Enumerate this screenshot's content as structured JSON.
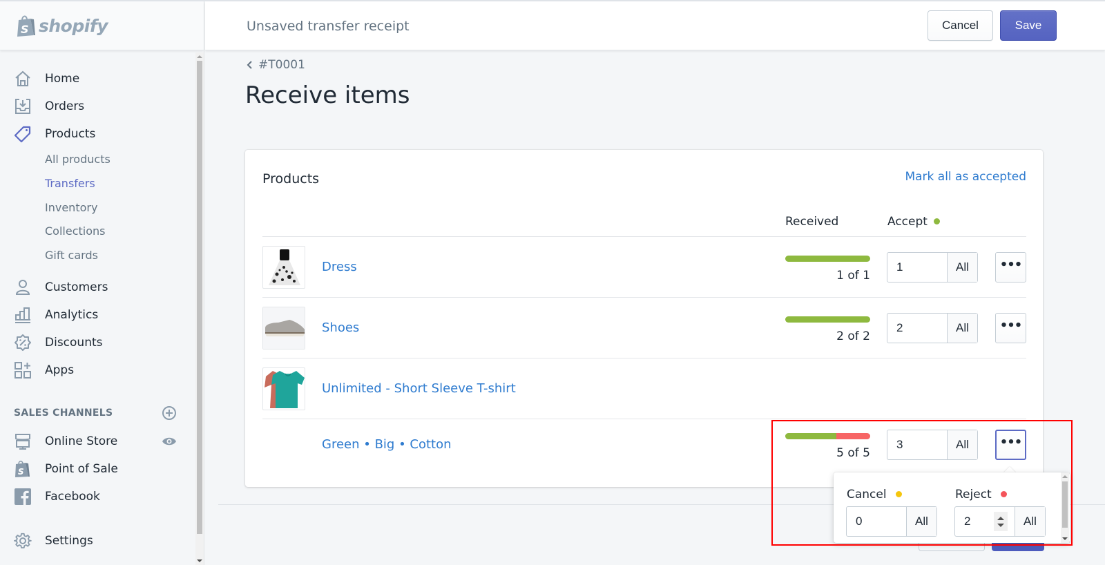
{
  "app": {
    "brand": "shopify"
  },
  "header": {
    "title": "Unsaved transfer receipt",
    "cancel_label": "Cancel",
    "save_label": "Save"
  },
  "sidebar": {
    "items": [
      {
        "label": "Home",
        "icon": "home-icon"
      },
      {
        "label": "Orders",
        "icon": "orders-icon"
      },
      {
        "label": "Products",
        "icon": "tag-icon",
        "active": true
      },
      {
        "label": "Customers",
        "icon": "customer-icon"
      },
      {
        "label": "Analytics",
        "icon": "analytics-icon"
      },
      {
        "label": "Discounts",
        "icon": "discount-icon"
      },
      {
        "label": "Apps",
        "icon": "apps-icon"
      }
    ],
    "product_subitems": [
      {
        "label": "All products"
      },
      {
        "label": "Transfers",
        "active": true
      },
      {
        "label": "Inventory"
      },
      {
        "label": "Collections"
      },
      {
        "label": "Gift cards"
      }
    ],
    "sales_channels_title": "SALES CHANNELS",
    "channels": [
      {
        "label": "Online Store",
        "icon": "store-icon"
      },
      {
        "label": "Point of Sale",
        "icon": "shopify-bag-icon"
      },
      {
        "label": "Facebook",
        "icon": "facebook-icon"
      }
    ],
    "settings_label": "Settings"
  },
  "page": {
    "breadcrumb": "#T0001",
    "title": "Receive items"
  },
  "card": {
    "title": "Products",
    "mark_all_label": "Mark all as accepted",
    "columns": {
      "received": "Received",
      "accept": "Accept"
    },
    "rows": [
      {
        "name": "Dress",
        "image": "dress",
        "received": 1,
        "total": 1,
        "received_text": "1 of 1",
        "accept_value": "1",
        "all_label": "All",
        "bar": {
          "accepted": 1.0,
          "rejected": 0.0
        }
      },
      {
        "name": "Shoes",
        "image": "shoes",
        "received": 2,
        "total": 2,
        "received_text": "2 of 2",
        "accept_value": "2",
        "all_label": "All",
        "bar": {
          "accepted": 1.0,
          "rejected": 0.0
        }
      },
      {
        "name": "Unlimited - Short Sleeve T-shirt",
        "image": "tshirt"
      },
      {
        "name": "Green • Big • Cotton",
        "variant": true,
        "received": 5,
        "total": 5,
        "received_text": "5 of 5",
        "accept_value": "3",
        "all_label": "All",
        "bar": {
          "accepted": 0.6,
          "rejected": 0.4
        }
      }
    ]
  },
  "popover": {
    "cancel_label": "Cancel",
    "cancel_value": "0",
    "reject_label": "Reject",
    "reject_value": "2",
    "all_label": "All"
  },
  "colors": {
    "accent": "#5c6ac4",
    "link": "#2e7bcf",
    "accepted": "#8eb93f",
    "rejected": "#f76565",
    "cancel_dot": "#f5c60d",
    "accept_dot": "#8eb93f",
    "reject_dot": "#f4545a"
  }
}
